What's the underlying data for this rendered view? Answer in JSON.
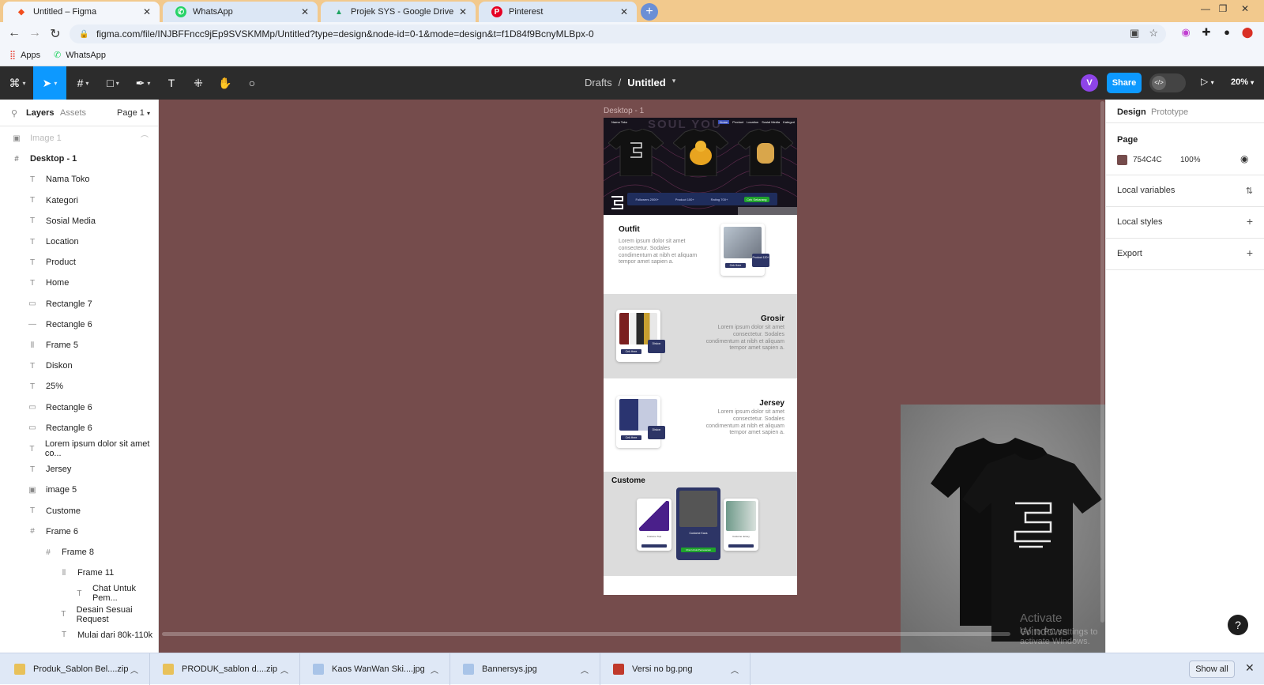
{
  "browser": {
    "tabs": [
      {
        "label": "Untitled – Figma",
        "icon": "figma-icon",
        "active": true
      },
      {
        "label": "WhatsApp",
        "icon": "whatsapp-icon",
        "active": false
      },
      {
        "label": "Projek SYS - Google Drive",
        "icon": "drive-icon",
        "active": false
      },
      {
        "label": "Pinterest",
        "icon": "pinterest-icon",
        "active": false
      }
    ],
    "url": "figma.com/file/INJBFFncc9jEp9SVSKMMp/Untitled?type=design&node-id=0-1&mode=design&t=f1D84f9BcnyMLBpx-0",
    "bookmarks": [
      {
        "label": "Apps"
      },
      {
        "label": "WhatsApp"
      }
    ]
  },
  "figma": {
    "toolbar": {
      "crumb_parent": "Drafts",
      "crumb_sep": "/",
      "file_name": "Untitled",
      "avatar_letter": "V",
      "share_label": "Share",
      "zoom": "20%"
    },
    "left": {
      "tab_layers": "Layers",
      "tab_assets": "Assets",
      "page_selector": "Page 1",
      "layers": [
        {
          "name": "Image 1",
          "type": "image",
          "indent": 1,
          "dim": true
        },
        {
          "name": "Desktop - 1",
          "type": "frame",
          "indent": 1,
          "bold": true
        },
        {
          "name": "Nama Toko",
          "type": "text",
          "indent": 2
        },
        {
          "name": "Kategori",
          "type": "text",
          "indent": 2
        },
        {
          "name": "Sosial Media",
          "type": "text",
          "indent": 2
        },
        {
          "name": "Location",
          "type": "text",
          "indent": 2
        },
        {
          "name": "Product",
          "type": "text",
          "indent": 2
        },
        {
          "name": "Home",
          "type": "text",
          "indent": 2
        },
        {
          "name": "Rectangle 7",
          "type": "rect",
          "indent": 2
        },
        {
          "name": "Rectangle 6",
          "type": "line",
          "indent": 2
        },
        {
          "name": "Frame 5",
          "type": "autolayout",
          "indent": 2
        },
        {
          "name": "Diskon",
          "type": "text",
          "indent": 2
        },
        {
          "name": "25%",
          "type": "text",
          "indent": 2
        },
        {
          "name": "Rectangle 6",
          "type": "rect",
          "indent": 2
        },
        {
          "name": "Rectangle 6",
          "type": "rect",
          "indent": 2
        },
        {
          "name": "Lorem ipsum dolor sit amet co...",
          "type": "text",
          "indent": 2
        },
        {
          "name": "Jersey",
          "type": "text",
          "indent": 2
        },
        {
          "name": "image 5",
          "type": "image",
          "indent": 2
        },
        {
          "name": "Custome",
          "type": "text",
          "indent": 2
        },
        {
          "name": "Frame 6",
          "type": "frame",
          "indent": 2
        },
        {
          "name": "Frame 8",
          "type": "frame",
          "indent": 3
        },
        {
          "name": "Frame 11",
          "type": "autolayout",
          "indent": 4
        },
        {
          "name": "Chat Untuk Pem...",
          "type": "text",
          "indent": 5
        },
        {
          "name": "Desain Sesuai Request",
          "type": "text",
          "indent": 4
        },
        {
          "name": "Mulai dari 80k-110k",
          "type": "text",
          "indent": 4
        }
      ]
    },
    "canvas": {
      "background": "#754C4C",
      "frame_label": "Desktop - 1",
      "hero": {
        "store_name": "Nama Toko",
        "nav_links": [
          "Home",
          "Product",
          "Location",
          "Sosial Media",
          "Kategori"
        ],
        "title": "SOUL YOU",
        "stats": [
          "Followers 2000+",
          "Product 100+",
          "Rating 700+",
          "Cek Sekarang"
        ]
      },
      "sections": [
        {
          "title": "Outfit",
          "body": "Lorem ipsum dolor sit amet consectetur. Sodales condimentum at nibh et aliquam tempor amet sapien a.",
          "button": "Cek Here",
          "tag": "Product 120+"
        },
        {
          "title": "Grosir",
          "body": "Lorem ipsum dolor sit amet consectetur. Sodales condimentum at nibh et aliquam tempor amet sapien a.",
          "button": "Cek Here",
          "tag": "Diskon"
        },
        {
          "title": "Jersey",
          "body": "Lorem ipsum dolor sit amet consectetur. Sodales condimentum at nibh et aliquam tempor amet sapien a.",
          "button": "Cek Here",
          "tag": "Diskon"
        }
      ],
      "custome": {
        "title": "Custome",
        "cards": [
          {
            "text": "Custome Topi"
          },
          {
            "text": "Custome Kaos"
          },
          {
            "text": "Custome Jersey"
          }
        ],
        "chat_label": "Chat Untuk Pemesanan"
      },
      "watermark_line1": "Activate Windows",
      "watermark_line2": "Go to PC settings to activate Windows."
    },
    "right": {
      "tab_design": "Design",
      "tab_prototype": "Prototype",
      "page_heading": "Page",
      "page_color_hex": "754C4C",
      "page_opacity": "100%",
      "rows": [
        {
          "label": "Local variables",
          "icon": "variables-icon"
        },
        {
          "label": "Local styles",
          "icon": "plus-icon"
        },
        {
          "label": "Export",
          "icon": "plus-icon"
        }
      ],
      "help": "?"
    }
  },
  "downloads": {
    "items": [
      {
        "label": "Produk_Sablon Bel....zip",
        "icon": "zip-icon"
      },
      {
        "label": "PRODUK_sablon d....zip",
        "icon": "zip-icon"
      },
      {
        "label": "Kaos WanWan Ski....jpg",
        "icon": "image-icon"
      },
      {
        "label": "Bannersys.jpg",
        "icon": "image-icon"
      },
      {
        "label": "Versi no bg.png",
        "icon": "image-icon"
      }
    ],
    "show_all": "Show all"
  }
}
